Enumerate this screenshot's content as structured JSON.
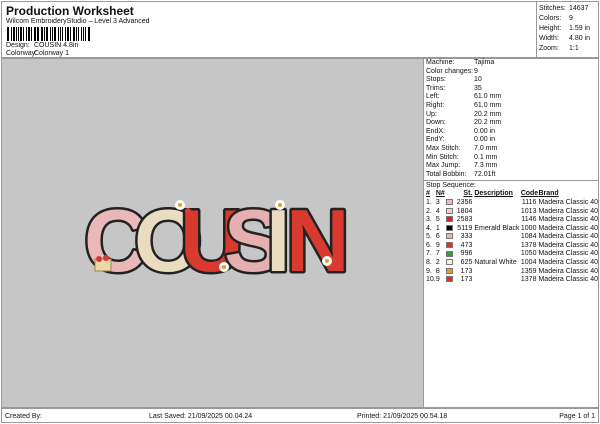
{
  "header": {
    "title": "Production Worksheet",
    "subtitle": "Wilcom EmbroideryStudio – Level 3 Advanced",
    "design_label": "Design:",
    "design": "COUSIN 4.8in",
    "colorway_label": "Colorway:",
    "colorway": "Colorway 1"
  },
  "stats": [
    {
      "k": "Stitches:",
      "v": "14637"
    },
    {
      "k": "Colors:",
      "v": "9"
    },
    {
      "k": "Height:",
      "v": "1.59 in"
    },
    {
      "k": "Width:",
      "v": "4.80 in"
    },
    {
      "k": "Zoom:",
      "v": "1:1"
    }
  ],
  "details": [
    {
      "k": "Machine:",
      "v": "Tajima"
    },
    {
      "k": "Color changes:",
      "v": "9"
    },
    {
      "k": "Stops:",
      "v": "10"
    },
    {
      "k": "Trims:",
      "v": "35"
    },
    {
      "k": "Left:",
      "v": "61.0 mm"
    },
    {
      "k": "Right:",
      "v": "61.0 mm"
    },
    {
      "k": "Up:",
      "v": "20.2 mm"
    },
    {
      "k": "Down:",
      "v": "20.2 mm"
    },
    {
      "k": "EndX:",
      "v": "0.00 in"
    },
    {
      "k": "EndY:",
      "v": "0.00 in"
    },
    {
      "k": "Max Stitch:",
      "v": "7.0 mm"
    },
    {
      "k": "Min Stitch:",
      "v": "0.1 mm"
    },
    {
      "k": "Max Jump:",
      "v": "7.3 mm"
    },
    {
      "k": "Total Bobbin:",
      "v": "72.01ft"
    }
  ],
  "stop_sequence": {
    "title": "Stop Sequence:",
    "headers": [
      "#",
      "N#",
      "St.",
      "Description",
      "Code",
      "Brand"
    ],
    "rows": [
      {
        "i": "1.",
        "n": "3",
        "color": "#f2b8c0",
        "st": "2356",
        "desc": "",
        "code": "1116",
        "brand": "Madeira Classic 40"
      },
      {
        "i": "2.",
        "n": "4",
        "color": "#f0d0d0",
        "st": "1804",
        "desc": "",
        "code": "1013",
        "brand": "Madeira Classic 40"
      },
      {
        "i": "3.",
        "n": "5",
        "color": "#e02020",
        "st": "2583",
        "desc": "",
        "code": "1146",
        "brand": "Madeira Classic 40"
      },
      {
        "i": "4.",
        "n": "1",
        "color": "#000000",
        "st": "5119",
        "desc": "Emerald Black",
        "code": "1000",
        "brand": "Madeira Classic 40"
      },
      {
        "i": "5.",
        "n": "6",
        "color": "#d8c0a0",
        "st": "333",
        "desc": "",
        "code": "1084",
        "brand": "Madeira Classic 40"
      },
      {
        "i": "6.",
        "n": "9",
        "color": "#e03020",
        "st": "473",
        "desc": "",
        "code": "1378",
        "brand": "Madeira Classic 40"
      },
      {
        "i": "7.",
        "n": "7",
        "color": "#30a040",
        "st": "996",
        "desc": "",
        "code": "1050",
        "brand": "Madeira Classic 40"
      },
      {
        "i": "8.",
        "n": "2",
        "color": "#f4f4f4",
        "st": "625",
        "desc": "Natural White",
        "code": "1004",
        "brand": "Madeira Classic 40"
      },
      {
        "i": "9.",
        "n": "8",
        "color": "#e0a020",
        "st": "173",
        "desc": "",
        "code": "1359",
        "brand": "Madeira Classic 40"
      },
      {
        "i": "10.",
        "n": "9",
        "color": "#e03020",
        "st": "173",
        "desc": "",
        "code": "1378",
        "brand": "Madeira Classic 40"
      }
    ]
  },
  "design_preview": {
    "text": "COUSIN"
  },
  "footer": {
    "created": "Created By:",
    "saved": "Last Saved: 21/09/2025 00.04.24",
    "printed": "Printed: 21/09/2025 00.54.18",
    "page": "Page 1 of 1"
  }
}
